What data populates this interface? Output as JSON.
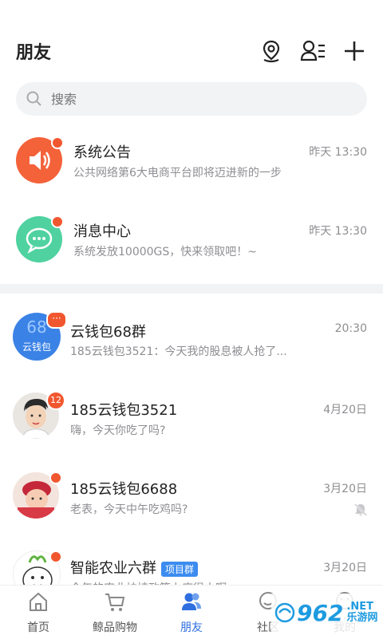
{
  "header": {
    "title": "朋友"
  },
  "search": {
    "placeholder": "搜索"
  },
  "conversations": [
    {
      "name": "系统公告",
      "preview": "公共网络第6大电商平台即将迈进新的一步",
      "time": "昨天 13:30"
    },
    {
      "name": "消息中心",
      "preview": "系统发放10000GS，快来领取吧！~",
      "time": "昨天 13:30"
    },
    {
      "name": "云钱包68群",
      "preview": "185云钱包3521：今天我的股息被人抢了...",
      "time": "20:30",
      "avatar_text": "云钱包",
      "avatar_number": "68",
      "badge": "···"
    },
    {
      "name": "185云钱包3521",
      "preview": "嗨，今天你吃了吗?",
      "time": "4月20日",
      "badge": "12"
    },
    {
      "name": "185云钱包6688",
      "preview": "老表，今天中午吃鸡吗?",
      "time": "3月20日"
    },
    {
      "name": "智能农业六群",
      "tag": "项目群",
      "preview": "今年的农业扶持政策力度很大啊",
      "time": "3月20日"
    }
  ],
  "tabbar": {
    "items": [
      {
        "label": "首页"
      },
      {
        "label": "鲸品购物"
      },
      {
        "label": "朋友"
      },
      {
        "label": "社区"
      },
      {
        "label": "我的"
      }
    ]
  },
  "watermark": {
    "text": "962",
    "suffix": "乐游网",
    "domain": ".NET"
  },
  "colors": {
    "accent": "#2f6fe0",
    "badge": "#f1572f",
    "announcement": "#f4623a",
    "message_center": "#4fd2a0"
  }
}
